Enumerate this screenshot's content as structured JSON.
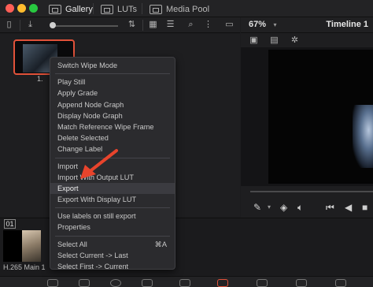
{
  "window": {
    "traffic_colors": [
      "#fe5f57",
      "#febc2e",
      "#28c840"
    ]
  },
  "tabs": [
    {
      "label": "Gallery",
      "icon": "gallery-icon"
    },
    {
      "label": "LUTs",
      "icon": "luts-icon"
    },
    {
      "label": "Media Pool",
      "icon": "media-pool-icon"
    }
  ],
  "viewer": {
    "zoom": "67%",
    "timeline_title": "Timeline 1"
  },
  "gallery": {
    "still_label": "1."
  },
  "context_menu": {
    "items": [
      {
        "label": "Switch Wipe Mode",
        "group": 1
      },
      {
        "label": "Play Still",
        "group": 2
      },
      {
        "label": "Apply Grade",
        "group": 2
      },
      {
        "label": "Append Node Graph",
        "group": 2
      },
      {
        "label": "Display Node Graph",
        "group": 2
      },
      {
        "label": "Match Reference Wipe Frame",
        "group": 2
      },
      {
        "label": "Delete Selected",
        "group": 2
      },
      {
        "label": "Change Label",
        "group": 2
      },
      {
        "label": "Import",
        "group": 3
      },
      {
        "label": "Import With Output LUT",
        "group": 3
      },
      {
        "label": "Export",
        "group": 3,
        "highlighted": true
      },
      {
        "label": "Export With Display LUT",
        "group": 3
      },
      {
        "label": "Use labels on still export",
        "group": 4
      },
      {
        "label": "Properties",
        "group": 4
      },
      {
        "label": "Select All",
        "group": 5,
        "shortcut": "⌘A"
      },
      {
        "label": "Select Current -> Last",
        "group": 5
      },
      {
        "label": "Select First -> Current",
        "group": 5
      }
    ]
  },
  "clip": {
    "number": "01",
    "label": "H.265 Main 1"
  },
  "annotation": {
    "arrow_color": "#e8442c"
  },
  "accent": "#e0523a"
}
